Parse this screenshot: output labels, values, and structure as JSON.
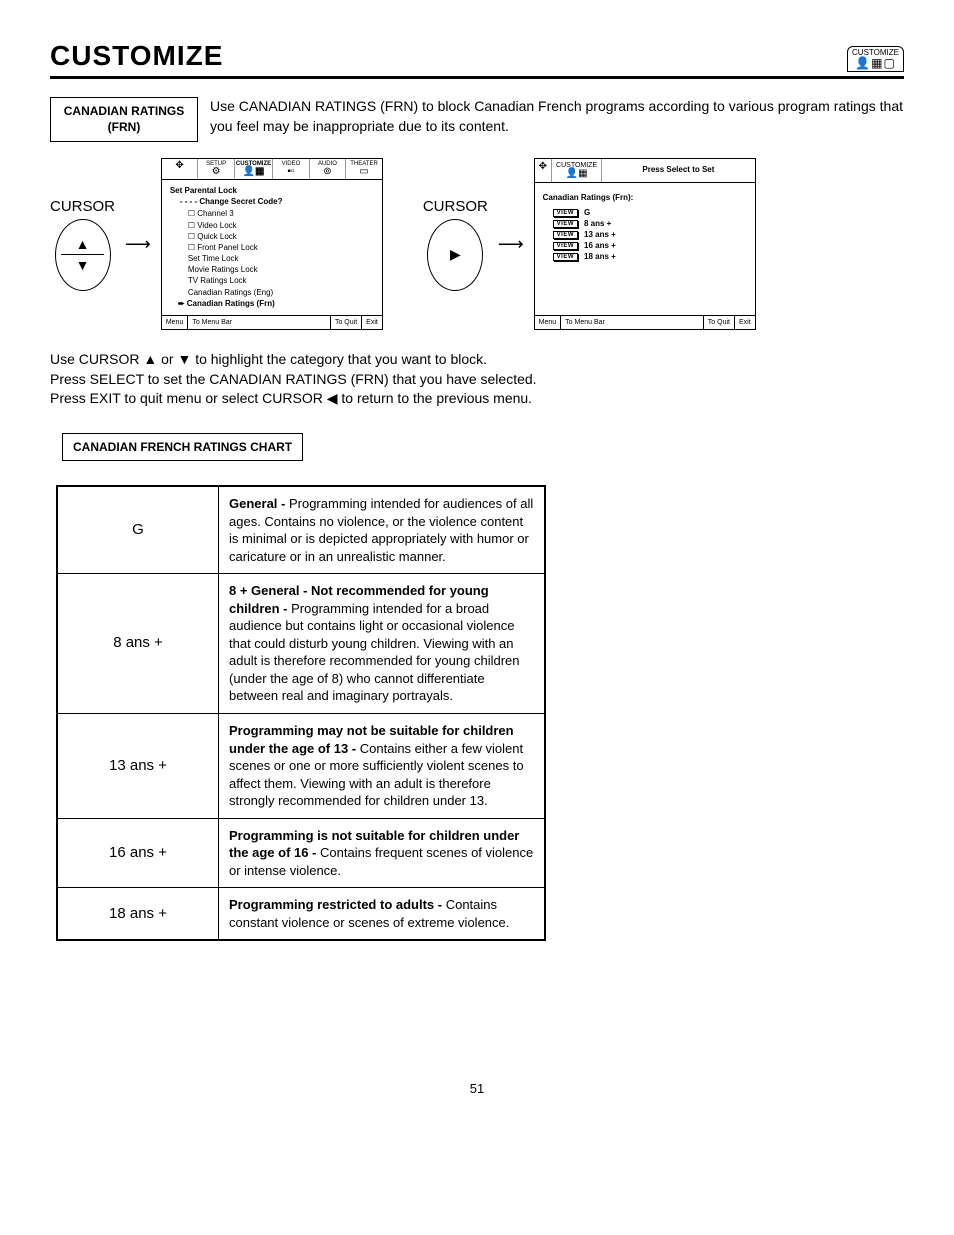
{
  "header": {
    "title": "CUSTOMIZE",
    "badge_label": "CUSTOMIZE"
  },
  "intro": {
    "box_line1": "CANADIAN RATINGS",
    "box_line2": "(FRN)",
    "text": "Use CANADIAN RATINGS (FRN) to block Canadian French programs according to various program ratings that you feel may be inappropriate due to its content."
  },
  "cursor_label": "CURSOR",
  "osd1": {
    "tabs": [
      "SETUP",
      "CUSTOMIZE",
      "VIDEO",
      "AUDIO",
      "THEATER"
    ],
    "heading": "Set Parental Lock",
    "sub": "- - - - Change Secret Code?",
    "items": [
      {
        "label": "Channel 3",
        "chk": true
      },
      {
        "label": "Video Lock",
        "chk": true
      },
      {
        "label": "Quick Lock",
        "chk": true
      },
      {
        "label": "Front Panel Lock",
        "chk": true
      },
      {
        "label": "Set Time Lock",
        "chk": false
      },
      {
        "label": "Movie Ratings Lock",
        "chk": false
      },
      {
        "label": "TV Ratings Lock",
        "chk": false
      },
      {
        "label": "Canadian Ratings (Eng)",
        "chk": false
      },
      {
        "label": "Canadian Ratings (Frn)",
        "chk": false,
        "sel": true
      }
    ],
    "footer": {
      "menu": "Menu",
      "bar": "To Menu Bar",
      "quit": "To Quit",
      "exit": "Exit"
    }
  },
  "osd2": {
    "tab_label": "CUSTOMIZE",
    "prompt": "Press Select to Set",
    "heading": "Canadian Ratings (Frn):",
    "ratings": [
      "G",
      "8 ans +",
      "13 ans +",
      "16 ans +",
      "18 ans +"
    ],
    "view": "VIEW",
    "footer": {
      "menu": "Menu",
      "bar": "To Menu Bar",
      "quit": "To Quit",
      "exit": "Exit"
    }
  },
  "instructions": {
    "l1a": "Use CURSOR ",
    "l1b": " or ",
    "l1c": " to highlight the category that you want to block.",
    "l2": "Press SELECT to set the CANADIAN RATINGS (FRN) that you have selected.",
    "l3a": "Press EXIT to quit menu or select CURSOR ",
    "l3b": " to return to the previous menu."
  },
  "chart_label": "CANADIAN FRENCH RATINGS CHART",
  "chart": [
    {
      "code": "G",
      "desc_bold": "General - ",
      "desc": "Programming intended for audiences of all ages.  Contains no violence, or the violence content is minimal or is depicted appropriately with humor or caricature or in an unrealistic manner."
    },
    {
      "code": "8 ans +",
      "desc_bold": "8 + General - Not recommended for young children -  ",
      "desc": "Programming intended for a broad audience but contains light or occasional violence that could disturb young children. Viewing with an adult is therefore recommended for young children (under the age of 8) who cannot differentiate between real and imaginary portrayals."
    },
    {
      "code": "13 ans +",
      "desc_bold": "Programming may not be suitable for children under the age of 13 - ",
      "desc": "Contains either a few violent scenes or one or more sufficiently violent scenes to affect them.  Viewing with an adult is therefore strongly recommended for children under 13."
    },
    {
      "code": "16 ans +",
      "desc_bold": "Programming is not suitable for children under the age of 16 - ",
      "desc": "Contains frequent scenes of violence or intense violence."
    },
    {
      "code": "18 ans +",
      "desc_bold": "Programming restricted to adults -  ",
      "desc": "Contains constant violence or scenes of extreme violence."
    }
  ],
  "page_number": "51"
}
